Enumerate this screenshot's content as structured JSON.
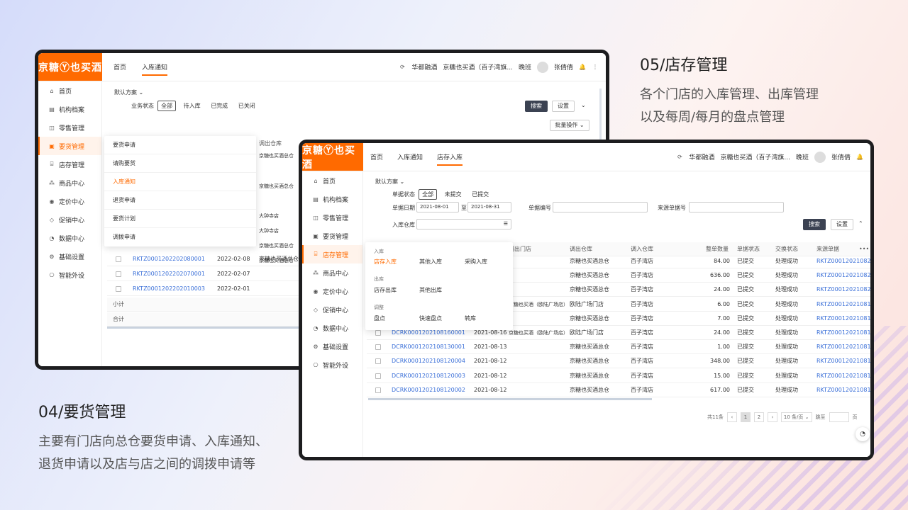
{
  "captions": {
    "c04": {
      "title": "04/要货管理",
      "lines": [
        "主要有门店向总仓要货申请、入库通知、",
        "退货申请以及店与店之间的调拨申请等"
      ]
    },
    "c05": {
      "title": "05/店存管理",
      "lines": [
        "各个门店的入库管理、出库管理",
        "以及每周/每月的盘点管理"
      ]
    }
  },
  "colors": {
    "brand": "#ff6a00",
    "link": "#3a6fd8",
    "dark_button": "#3b4252"
  },
  "back": {
    "logo": "京糖Ⓨ也买酒",
    "tabs": [
      {
        "label": "首页"
      },
      {
        "label": "入库通知"
      }
    ],
    "header": {
      "org": "华都融酒",
      "shop": "京糖也买酒（百子湾旗...",
      "shift": "晚班",
      "user": "张倩倩"
    },
    "sidebar": [
      "首页",
      "机构档案",
      "零售管理",
      "要货管理",
      "店存管理",
      "商品中心",
      "定价中心",
      "促销中心",
      "数据中心",
      "基础设置",
      "智能外设"
    ],
    "scheme": "默认方案",
    "status_label": "业务状态",
    "status_chips": [
      "全部",
      "待入库",
      "已完成",
      "已关闭"
    ],
    "search": "搜索",
    "settings": "设置",
    "batch": "批量操作",
    "col_partial": "调出仓库",
    "flyout": [
      "要货申请",
      "请购要货",
      "入库通知",
      "退货申请",
      "要货计划",
      "调拨申请"
    ],
    "warehouse_cells": [
      "京糖也买酒总仓",
      "京糖也买酒总仓",
      "大钟寺店",
      "大钟寺店",
      "京糖也买酒总仓",
      "京糖也买酒总仓"
    ],
    "rows": [
      {
        "no": "RKTZ0001202202080001",
        "date": "2022-02-08",
        "wh": "京糖也买酒总仓"
      },
      {
        "no": "RKTZ0001202202070001",
        "date": "2022-02-07",
        "wh": ""
      },
      {
        "no": "RKTZ0001202202010003",
        "date": "2022-02-01",
        "wh": ""
      }
    ],
    "subtotal": "小计",
    "total": "合计"
  },
  "front": {
    "logo": "京糖Ⓨ也买酒",
    "tabs": [
      {
        "label": "首页"
      },
      {
        "label": "入库通知"
      },
      {
        "label": "店存入库"
      }
    ],
    "header": {
      "org": "华都融酒",
      "shop": "京糖也买酒（百子湾旗...",
      "shift": "晚班",
      "user": "张倩倩"
    },
    "sidebar": [
      "首页",
      "机构档案",
      "零售管理",
      "要货管理",
      "店存管理",
      "商品中心",
      "定价中心",
      "促销中心",
      "数据中心",
      "基础设置",
      "智能外设"
    ],
    "scheme": "默认方案",
    "status_label": "单据状态",
    "status_chips": [
      "全部",
      "未提交",
      "已提交"
    ],
    "date_label": "单据日期",
    "date_from": "2021-08-01",
    "date_sep": "至",
    "date_to": "2021-08-31",
    "doc_no_label": "单据编号",
    "source_no_label": "来源单据号",
    "warehouse_label": "入库仓库",
    "search": "搜索",
    "settings": "设置",
    "columns": [
      "调出门店",
      "调出仓库",
      "调入仓库",
      "整单数量",
      "单据状态",
      "交换状态",
      "来源单据"
    ],
    "flyout": {
      "groups": [
        {
          "title": "入库",
          "items": [
            "店存入库",
            "其他入库",
            "采购入库"
          ]
        },
        {
          "title": "出库",
          "items": [
            "店存出库",
            "其他出库"
          ]
        },
        {
          "title": "调整",
          "items": [
            "盘点",
            "快速盘点",
            "转库"
          ]
        }
      ]
    },
    "top_rows": [
      {
        "out_wh": "京糖也买酒总仓",
        "in_wh": "百子湾店",
        "qty": "84.00",
        "status": "已提交",
        "xstatus": "处理成功",
        "src": "RKTZ000120210826"
      },
      {
        "out_wh": "京糖也买酒总仓",
        "in_wh": "百子湾店",
        "qty": "636.00",
        "status": "已提交",
        "xstatus": "处理成功",
        "src": "RKTZ000120210825"
      },
      {
        "out_wh": "京糖也买酒总仓",
        "in_wh": "百子湾店",
        "qty": "24.00",
        "status": "已提交",
        "xstatus": "处理成功",
        "src": "RKTZ000120210820"
      },
      {
        "out_store": "京糖也买酒（欧陆广场店）",
        "out_wh": "欧陆广场门店",
        "in_wh": "百子湾店",
        "qty": "6.00",
        "status": "已提交",
        "xstatus": "处理成功",
        "src": "RKTZ000120210817"
      },
      {
        "out_wh": "京糖也买酒总仓",
        "in_wh": "百子湾店",
        "qty": "7.00",
        "status": "已提交",
        "xstatus": "处理成功",
        "src": "RKTZ000120210816"
      }
    ],
    "rows": [
      {
        "no": "DCRK0001202108160001",
        "date": "2021-08-16",
        "out_store": "京糖也买酒（欧陆广场店）",
        "out_wh": "欧陆广场门店",
        "in_wh": "百子湾店",
        "qty": "24.00",
        "status": "已提交",
        "xstatus": "处理成功",
        "src": "RKTZ000120210816"
      },
      {
        "no": "DCRK0001202108130001",
        "date": "2021-08-13",
        "out_store": "",
        "out_wh": "京糖也买酒总仓",
        "in_wh": "百子湾店",
        "qty": "1.00",
        "status": "已提交",
        "xstatus": "处理成功",
        "src": "RKTZ000120210812"
      },
      {
        "no": "DCRK0001202108120004",
        "date": "2021-08-12",
        "out_store": "",
        "out_wh": "京糖也买酒总仓",
        "in_wh": "百子湾店",
        "qty": "348.00",
        "status": "已提交",
        "xstatus": "处理成功",
        "src": "RKTZ000120210812"
      },
      {
        "no": "DCRK0001202108120003",
        "date": "2021-08-12",
        "out_store": "",
        "out_wh": "京糖也买酒总仓",
        "in_wh": "百子湾店",
        "qty": "15.00",
        "status": "已提交",
        "xstatus": "处理成功",
        "src": "RKTZ000120210812"
      },
      {
        "no": "DCRK0001202108120002",
        "date": "2021-08-12",
        "out_store": "",
        "out_wh": "京糖也买酒总仓",
        "in_wh": "百子湾店",
        "qty": "617.00",
        "status": "已提交",
        "xstatus": "处理成功",
        "src": "RKTZ000120210812"
      }
    ],
    "pagination": {
      "total": "共11条",
      "pages": [
        "1",
        "2"
      ],
      "current": "1",
      "page_size": "10 条/页",
      "goto": "跳至",
      "page_suffix": "页"
    }
  }
}
